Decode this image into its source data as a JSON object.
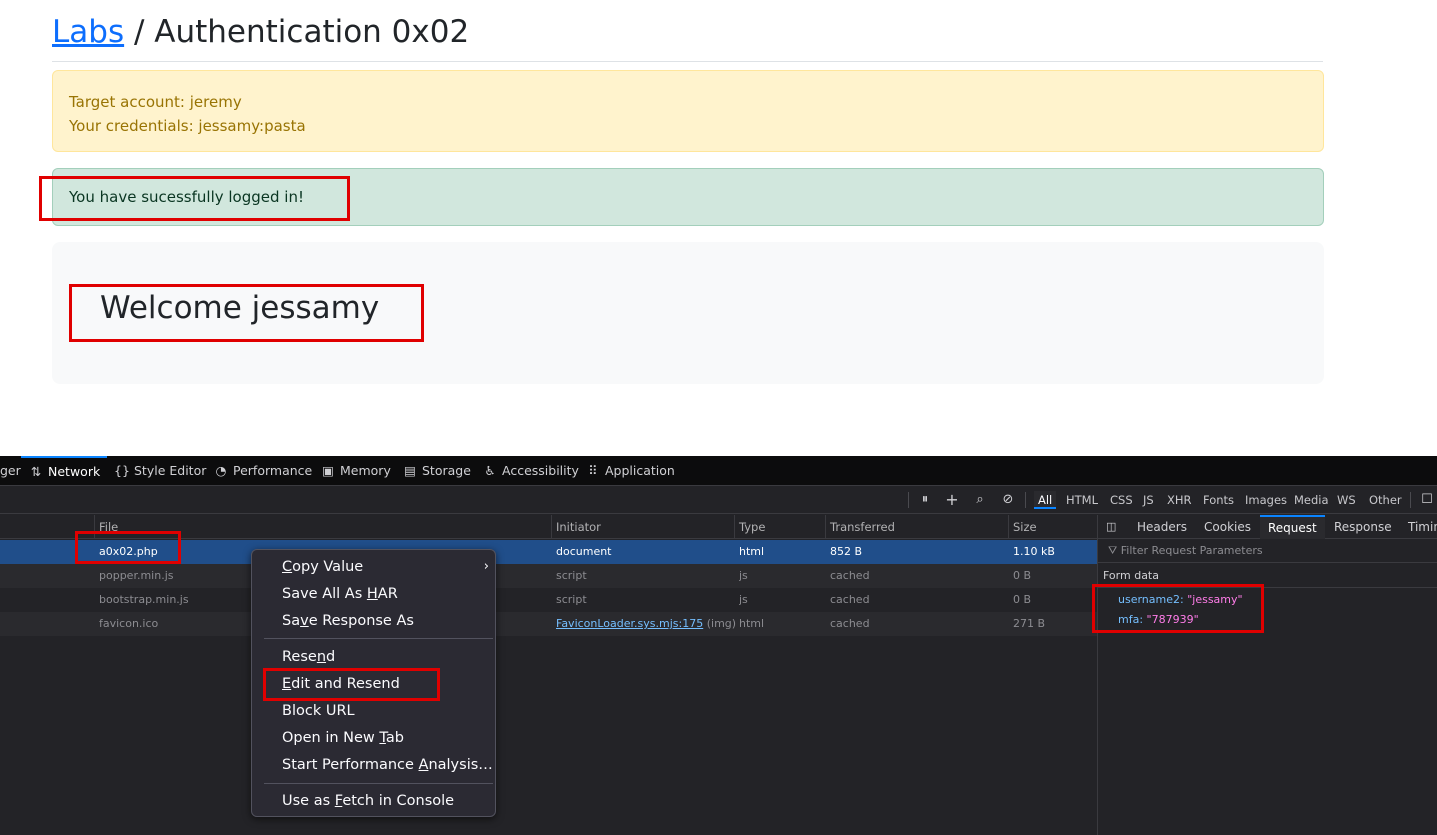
{
  "page": {
    "breadcrumb_link": "Labs",
    "breadcrumb_rest": " / Authentication 0x02",
    "target_account": "Target account: jeremy",
    "credentials": "Your credentials: jessamy:pasta",
    "success_message": "You have sucessfully logged in!",
    "welcome": "Welcome jessamy"
  },
  "devtools": {
    "tabs": [
      {
        "label": "ger",
        "icon": ""
      },
      {
        "label": "Network",
        "icon": "network-icon"
      },
      {
        "label": "Style Editor",
        "icon": "braces-icon"
      },
      {
        "label": "Performance",
        "icon": "gauge-icon"
      },
      {
        "label": "Memory",
        "icon": "chip-icon"
      },
      {
        "label": "Storage",
        "icon": "storage-icon"
      },
      {
        "label": "Accessibility",
        "icon": "accessibility-icon"
      },
      {
        "label": "Application",
        "icon": "grid-icon"
      }
    ],
    "filters": [
      "All",
      "HTML",
      "CSS",
      "JS",
      "XHR",
      "Fonts",
      "Images",
      "Media",
      "WS",
      "Other"
    ],
    "columns": [
      "File",
      "Initiator",
      "Type",
      "Transferred",
      "Size"
    ],
    "rows": [
      {
        "file": "a0x02.php",
        "initiator": "document",
        "initiator_extra": "",
        "type": "html",
        "transferred": "852 B",
        "size": "1.10 kB"
      },
      {
        "file": "popper.min.js",
        "initiator": "script",
        "initiator_extra": "",
        "type": "js",
        "transferred": "cached",
        "size": "0 B"
      },
      {
        "file": "bootstrap.min.js",
        "initiator": "script",
        "initiator_extra": "",
        "type": "js",
        "transferred": "cached",
        "size": "0 B"
      },
      {
        "file": "favicon.ico",
        "initiator": "FaviconLoader.sys.mjs:175",
        "initiator_extra": " (img)",
        "type": "html",
        "transferred": "cached",
        "size": "271 B"
      }
    ],
    "side_tabs": [
      "Headers",
      "Cookies",
      "Request",
      "Response",
      "Timin"
    ],
    "filter_placeholder": "Filter Request Parameters",
    "form_title": "Form data",
    "params": [
      {
        "key": "username2:",
        "value": "\"jessamy\""
      },
      {
        "key": "mfa:",
        "value": "\"787939\""
      }
    ]
  },
  "context_menu": {
    "items": [
      {
        "pre": "",
        "u": "C",
        "post": "opy Value",
        "submenu": true
      },
      {
        "pre": "Save All As ",
        "u": "H",
        "post": "AR",
        "submenu": false
      },
      {
        "pre": "Sa",
        "u": "v",
        "post": "e Response As",
        "submenu": false
      },
      {
        "pre": "Rese",
        "u": "n",
        "post": "d",
        "submenu": false
      },
      {
        "pre": "",
        "u": "E",
        "post": "dit and Resend",
        "submenu": false
      },
      {
        "pre": "Block URL",
        "u": "",
        "post": "",
        "submenu": false
      },
      {
        "pre": "Open in New ",
        "u": "T",
        "post": "ab",
        "submenu": false
      },
      {
        "pre": "Start Performance ",
        "u": "A",
        "post": "nalysis…",
        "submenu": false
      },
      {
        "pre": "Use as ",
        "u": "F",
        "post": "etch in Console",
        "submenu": false
      }
    ]
  }
}
